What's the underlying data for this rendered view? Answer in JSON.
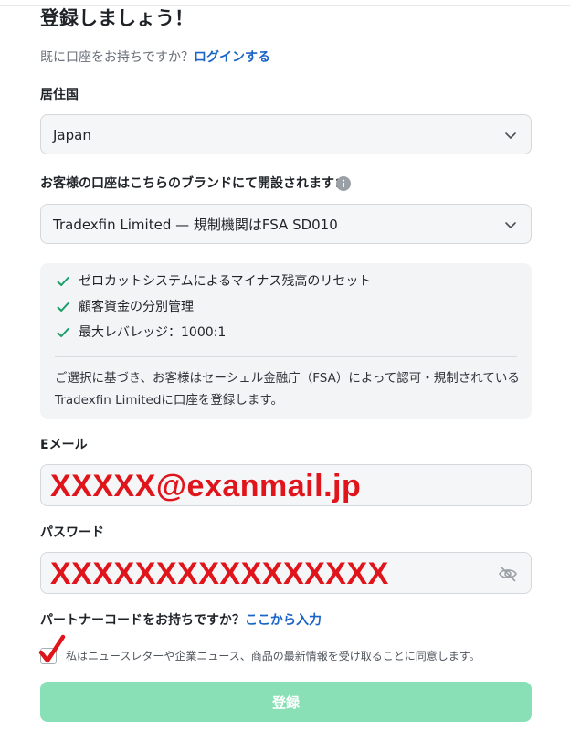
{
  "page": {
    "title": "登録しましょう！",
    "login_prompt": "既に口座をお持ちですか？",
    "login_link": "ログインする"
  },
  "residence": {
    "label": "居住国",
    "value": "Japan",
    "icon": "chevron-down-icon"
  },
  "brand": {
    "label": "お客様の口座はこちらのブランドにて開設されます：",
    "value": "Tradexfin Limited — 規制機関はFSA SD010",
    "info_icon": "info-icon"
  },
  "features": {
    "items": [
      "ゼロカットシステムによるマイナス残高のリセット",
      "顧客資金の分別管理",
      "最大レバレッジ：1000:1"
    ],
    "description": "ご選択に基づき、お客様はセーシェル金融庁（FSA）によって認可・規制されているTradexfin Limitedに口座を登録します。",
    "check_color": "#1a9e6a"
  },
  "email": {
    "label": "Eメール",
    "value": "XXXXX@exanmail.jp"
  },
  "password": {
    "label": "パスワード",
    "value": "XXXXXXXXXXXXXXXX",
    "icon": "eye-off-icon"
  },
  "partner": {
    "prompt": "パートナーコードをお持ちですか？",
    "link": "ここから入力"
  },
  "consent": {
    "text": "私はニュースレターや企業ニュース、商品の最新情報を受け取ることに同意します。",
    "checked": true
  },
  "submit": {
    "label": "登録",
    "color": "#89e0b6"
  },
  "colors": {
    "link": "#1a64c8",
    "masked_text": "#e0141b"
  }
}
